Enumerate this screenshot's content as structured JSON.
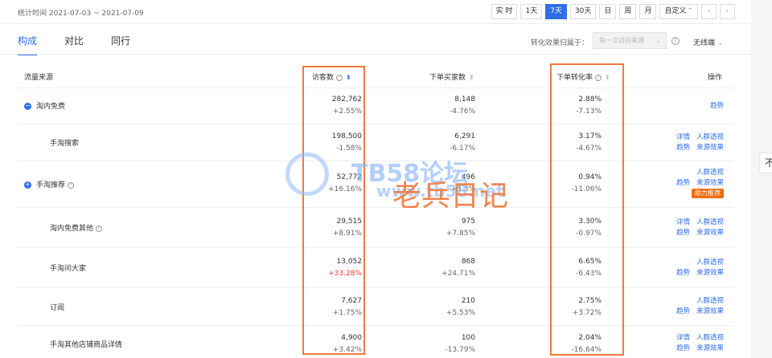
{
  "header": {
    "stat_time": "统计时间 2021-07-03 ~ 2021-07-09",
    "ranges": [
      "实 时",
      "1天",
      "7天",
      "30天",
      "日",
      "周",
      "月",
      "自定义"
    ],
    "custom_chevron": "⌃",
    "prev": "‹",
    "next": "›"
  },
  "tabs": [
    "构成",
    "对比",
    "同行"
  ],
  "attribution": {
    "label": "转化效果归属于：",
    "select_value": "每一次访问来源",
    "device": "无线端"
  },
  "columns": {
    "source": "流量来源",
    "visitors": "访客数",
    "buyers": "下单买家数",
    "conversion": "下单转化率",
    "actions": "操作"
  },
  "rows": [
    {
      "name": "淘内免费",
      "visitors": "282,762",
      "visitors_change": "+2.55%",
      "buyers": "8,148",
      "buyers_change": "-4.76%",
      "rate": "2.88%",
      "rate_change": "-7.13%"
    },
    {
      "name": "手淘搜索",
      "visitors": "198,500",
      "visitors_change": "-1.58%",
      "buyers": "6,291",
      "buyers_change": "-6.17%",
      "rate": "3.17%",
      "rate_change": "-4.67%"
    },
    {
      "name": "手淘推荐",
      "visitors": "52,772",
      "visitors_change": "+16.16%",
      "buyers": "496",
      "buyers_change": "+3.3%",
      "rate": "0.94%",
      "rate_change": "-11.06%"
    },
    {
      "name": "淘内免费其他",
      "visitors": "29,515",
      "visitors_change": "+8.91%",
      "buyers": "975",
      "buyers_change": "+7.85%",
      "rate": "3.30%",
      "rate_change": "-0.97%"
    },
    {
      "name": "手淘问大家",
      "visitors": "13,052",
      "visitors_change": "+33.28%",
      "buyers": "868",
      "buyers_change": "+24.71%",
      "rate": "6.65%",
      "rate_change": "-6.43%"
    },
    {
      "name": "订阅",
      "visitors": "7,627",
      "visitors_change": "+1.75%",
      "buyers": "210",
      "buyers_change": "+5.53%",
      "rate": "2.75%",
      "rate_change": "+3.72%"
    },
    {
      "name": "手淘其他店铺商品详情",
      "visitors": "4,900",
      "visitors_change": "+3.42%",
      "buyers": "100",
      "buyers_change": "-13.79%",
      "rate": "2.04%",
      "rate_change": "-16.64%"
    }
  ],
  "actions": {
    "detail": "详情",
    "trend": "趋势",
    "crowd": "人群透视",
    "source_effect": "来源效果",
    "boost": "助力推荐"
  },
  "watermark": {
    "site": "TB58论坛",
    "url": "www.tb58.net",
    "diary": "老兵日记"
  },
  "side_button": "不",
  "colors": {
    "accent": "#2f6ee9",
    "highlight": "#f0793d",
    "badge": "#f36c0c",
    "negative_emphasis": "#ff3333"
  }
}
